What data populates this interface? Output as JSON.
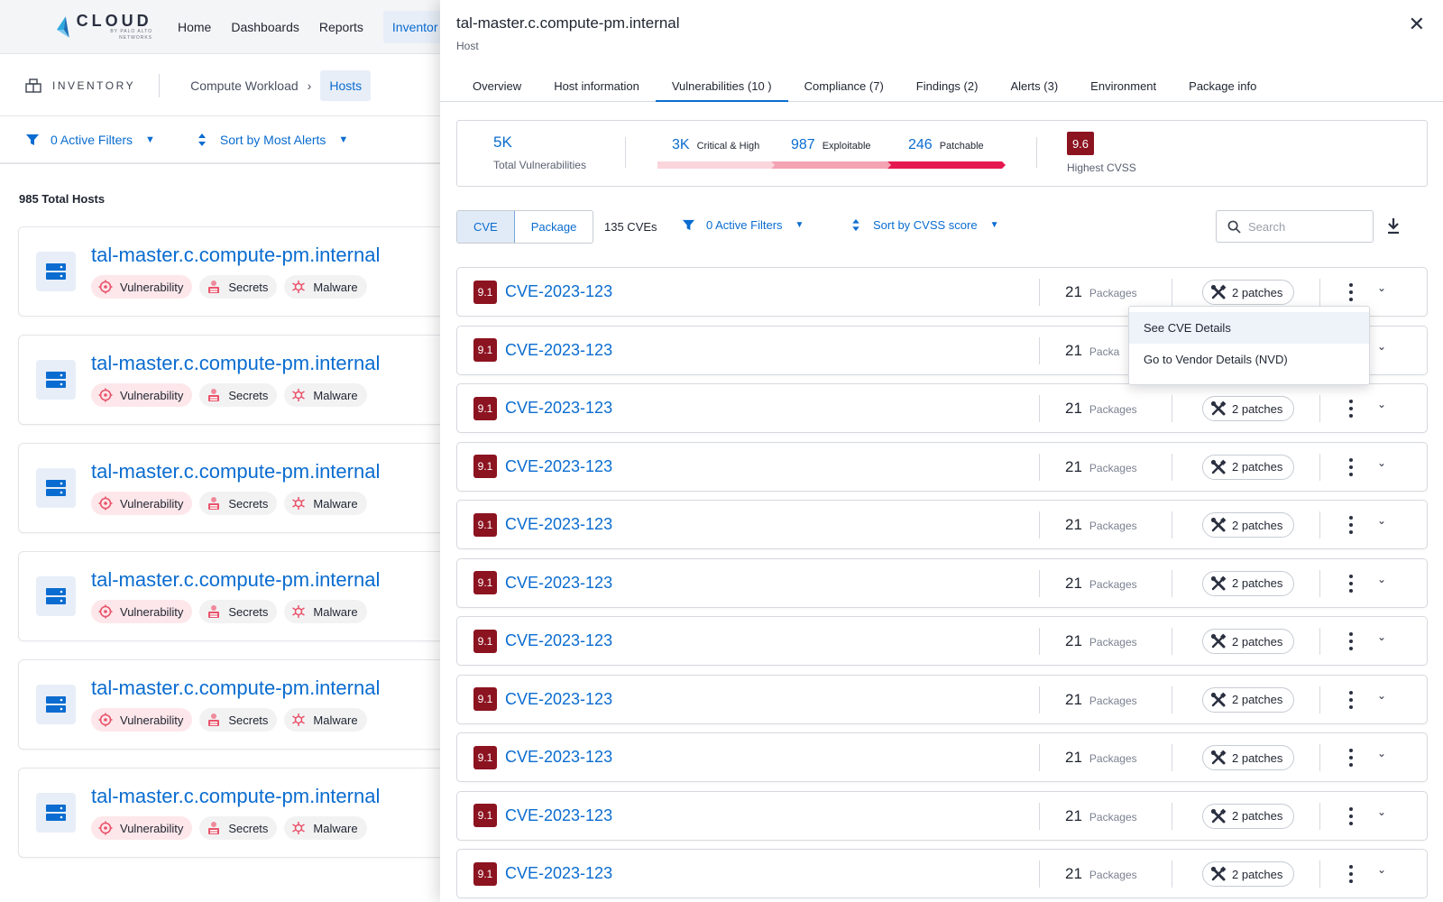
{
  "topnav": {
    "logo_word": "CLOUD",
    "logo_sub": "BY PALO ALTO NETWORKS",
    "links": [
      "Home",
      "Dashboards",
      "Reports",
      "Inventor"
    ]
  },
  "inventory_bar": {
    "label": "INVENTORY",
    "breadcrumb": [
      "Compute Workload",
      "Hosts"
    ]
  },
  "left_filters": {
    "filters_label": "0 Active Filters",
    "sort_label": "Sort by Most Alerts"
  },
  "hosts": {
    "total_label": "985 Total Hosts",
    "items": [
      {
        "name": "tal-master.c.compute-pm.internal",
        "tags": [
          "Vulnerability",
          "Secrets",
          "Malware"
        ]
      },
      {
        "name": "tal-master.c.compute-pm.internal",
        "tags": [
          "Vulnerability",
          "Secrets",
          "Malware"
        ]
      },
      {
        "name": "tal-master.c.compute-pm.internal",
        "tags": [
          "Vulnerability",
          "Secrets",
          "Malware"
        ]
      },
      {
        "name": "tal-master.c.compute-pm.internal",
        "tags": [
          "Vulnerability",
          "Secrets",
          "Malware"
        ]
      },
      {
        "name": "tal-master.c.compute-pm.internal",
        "tags": [
          "Vulnerability",
          "Secrets",
          "Malware"
        ]
      },
      {
        "name": "tal-master.c.compute-pm.internal",
        "tags": [
          "Vulnerability",
          "Secrets",
          "Malware"
        ]
      }
    ]
  },
  "drawer": {
    "title": "tal-master.c.compute-pm.internal",
    "subtitle": "Host",
    "close": "✕",
    "tabs": [
      "Overview",
      "Host information",
      "Vulnerabilities (10 )",
      "Compliance (7)",
      "Findings (2)",
      "Alerts (3)",
      "Environment",
      "Package info"
    ],
    "active_tab": "Vulnerabilities (10 )",
    "summary": {
      "total_value": "5K",
      "total_label": "Total Vulnerabilities",
      "critical_value": "3K",
      "critical_label": "Critical & High",
      "exploitable_value": "987",
      "exploitable_label": "Exploitable",
      "patchable_value": "246",
      "patchable_label": "Patchable",
      "highest_cvss_value": "9.6",
      "highest_cvss_label": "Highest CVSS"
    },
    "toolbar": {
      "seg_cve": "CVE",
      "seg_package": "Package",
      "cve_count": "135 CVEs",
      "filters_label": "0 Active Filters",
      "sort_label": "Sort by CVSS score",
      "search_placeholder": "Search"
    },
    "cves": [
      {
        "score": "9.1",
        "id": "CVE-2023-123",
        "packages": "21",
        "packages_label": "Packages",
        "patches": "2 patches"
      },
      {
        "score": "9.1",
        "id": "CVE-2023-123",
        "packages": "21",
        "packages_label": "Packa",
        "patches": ""
      },
      {
        "score": "9.1",
        "id": "CVE-2023-123",
        "packages": "21",
        "packages_label": "Packages",
        "patches": "2 patches"
      },
      {
        "score": "9.1",
        "id": "CVE-2023-123",
        "packages": "21",
        "packages_label": "Packages",
        "patches": "2 patches"
      },
      {
        "score": "9.1",
        "id": "CVE-2023-123",
        "packages": "21",
        "packages_label": "Packages",
        "patches": "2 patches"
      },
      {
        "score": "9.1",
        "id": "CVE-2023-123",
        "packages": "21",
        "packages_label": "Packages",
        "patches": "2 patches"
      },
      {
        "score": "9.1",
        "id": "CVE-2023-123",
        "packages": "21",
        "packages_label": "Packages",
        "patches": "2 patches"
      },
      {
        "score": "9.1",
        "id": "CVE-2023-123",
        "packages": "21",
        "packages_label": "Packages",
        "patches": "2 patches"
      },
      {
        "score": "9.1",
        "id": "CVE-2023-123",
        "packages": "21",
        "packages_label": "Packages",
        "patches": "2 patches"
      },
      {
        "score": "9.1",
        "id": "CVE-2023-123",
        "packages": "21",
        "packages_label": "Packages",
        "patches": "2 patches"
      },
      {
        "score": "9.1",
        "id": "CVE-2023-123",
        "packages": "21",
        "packages_label": "Packages",
        "patches": "2 patches"
      }
    ],
    "context_menu": [
      "See CVE Details",
      "Go to Vendor Details (NVD)"
    ]
  },
  "colors": {
    "accent": "#0a6cd0",
    "severity_critical": "#8c1320",
    "bar_critical": "#fbd5dc",
    "bar_exploitable": "#f3a3b3",
    "bar_patchable": "#e5194f"
  }
}
